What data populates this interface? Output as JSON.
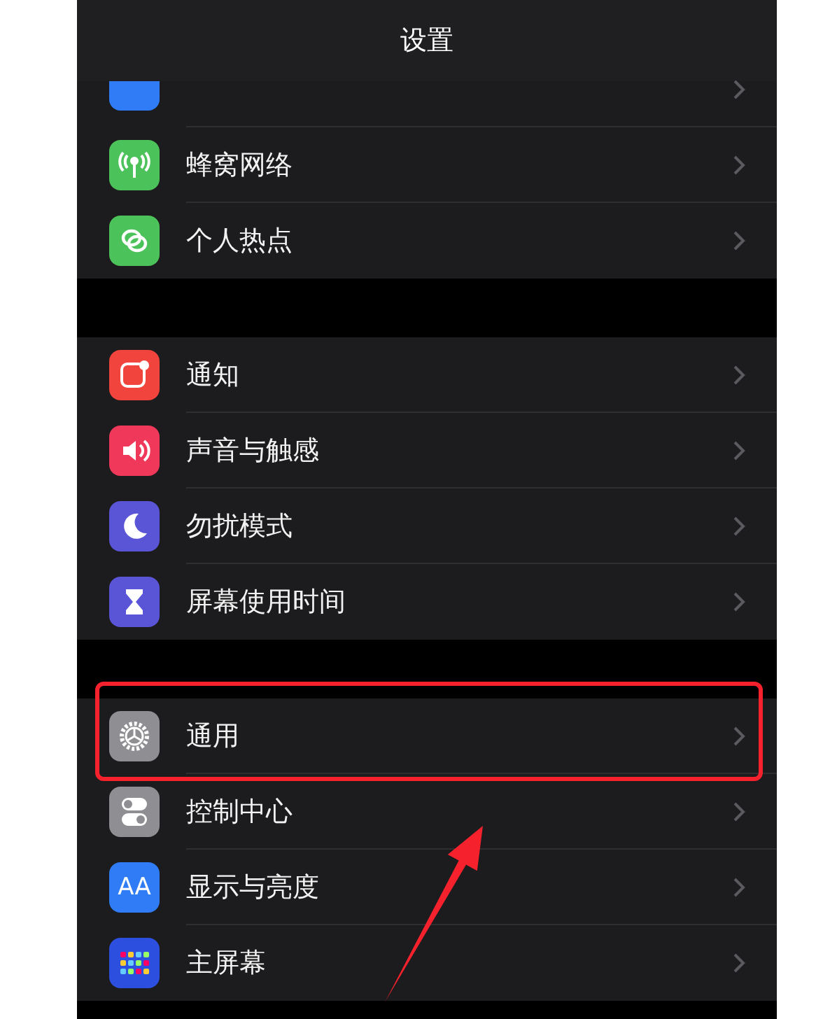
{
  "header": {
    "title": "设置"
  },
  "pointer_arrow": true,
  "groups": [
    {
      "items": [
        {
          "kind": "bluetooth",
          "cut": true,
          "marked": false
        },
        {
          "label": "蜂窝网络",
          "kind": "antenna",
          "marked": false
        },
        {
          "label": "个人热点",
          "kind": "link",
          "marked": false
        }
      ]
    },
    {
      "items": [
        {
          "label": "通知",
          "kind": "notification",
          "marked": false
        },
        {
          "label": "声音与触感",
          "kind": "sound",
          "marked": false
        },
        {
          "label": "勿扰模式",
          "kind": "moon",
          "marked": false
        },
        {
          "label": "屏幕使用时间",
          "kind": "hourglass",
          "marked": false
        }
      ]
    },
    {
      "items": [
        {
          "label": "通用",
          "kind": "gear",
          "marked": true
        },
        {
          "label": "控制中心",
          "kind": "toggles",
          "marked": false
        },
        {
          "label": "显示与亮度",
          "kind": "text",
          "icon_text": "AA",
          "marked": false
        },
        {
          "label": "主屏幕",
          "kind": "grid",
          "marked": false
        }
      ]
    }
  ]
}
